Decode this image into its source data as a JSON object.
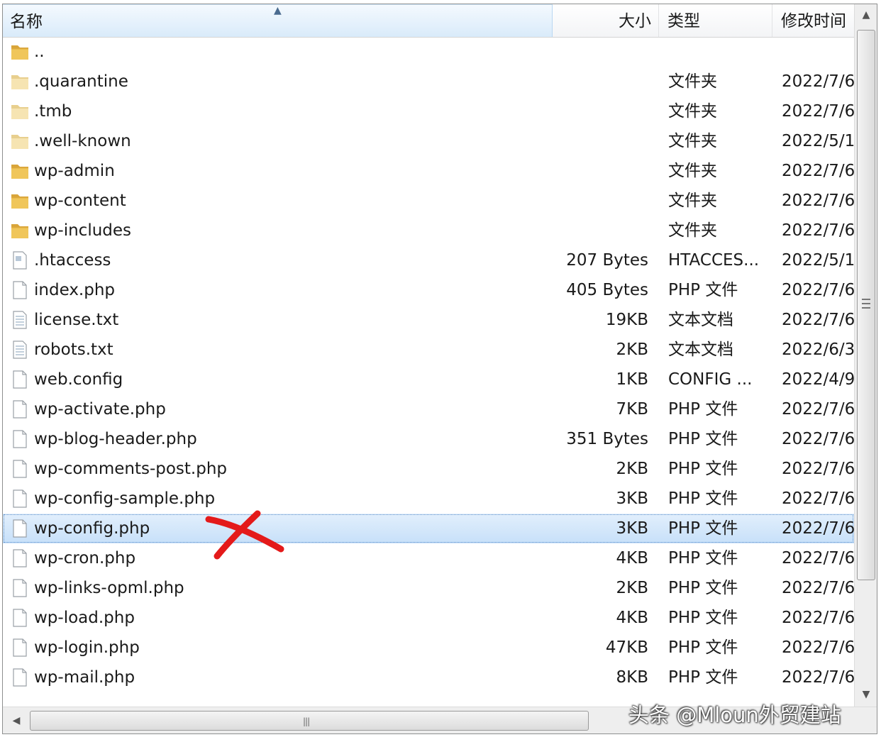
{
  "columns": {
    "name": "名称",
    "size": "大小",
    "type": "类型",
    "date": "修改时间"
  },
  "rows": [
    {
      "icon": "folder-icon",
      "name": "..",
      "size": "",
      "type": "",
      "date": ""
    },
    {
      "icon": "folder-light-icon",
      "name": ".quarantine",
      "size": "",
      "type": "文件夹",
      "date": "2022/7/6"
    },
    {
      "icon": "folder-light-icon",
      "name": ".tmb",
      "size": "",
      "type": "文件夹",
      "date": "2022/7/6"
    },
    {
      "icon": "folder-light-icon",
      "name": ".well-known",
      "size": "",
      "type": "文件夹",
      "date": "2022/5/1"
    },
    {
      "icon": "folder-icon",
      "name": "wp-admin",
      "size": "",
      "type": "文件夹",
      "date": "2022/7/6"
    },
    {
      "icon": "folder-icon",
      "name": "wp-content",
      "size": "",
      "type": "文件夹",
      "date": "2022/7/6"
    },
    {
      "icon": "folder-icon",
      "name": "wp-includes",
      "size": "",
      "type": "文件夹",
      "date": "2022/7/6"
    },
    {
      "icon": "htaccess-file-icon",
      "name": ".htaccess",
      "size": "207 Bytes",
      "type": "HTACCES...",
      "date": "2022/5/1"
    },
    {
      "icon": "file-icon",
      "name": "index.php",
      "size": "405 Bytes",
      "type": "PHP 文件",
      "date": "2022/7/6"
    },
    {
      "icon": "text-file-icon",
      "name": "license.txt",
      "size": "19KB",
      "type": "文本文档",
      "date": "2022/7/6"
    },
    {
      "icon": "text-file-icon",
      "name": "robots.txt",
      "size": "2KB",
      "type": "文本文档",
      "date": "2022/6/3"
    },
    {
      "icon": "file-icon",
      "name": "web.config",
      "size": "1KB",
      "type": "CONFIG ...",
      "date": "2022/4/9"
    },
    {
      "icon": "file-icon",
      "name": "wp-activate.php",
      "size": "7KB",
      "type": "PHP 文件",
      "date": "2022/7/6"
    },
    {
      "icon": "file-icon",
      "name": "wp-blog-header.php",
      "size": "351 Bytes",
      "type": "PHP 文件",
      "date": "2022/7/6"
    },
    {
      "icon": "file-icon",
      "name": "wp-comments-post.php",
      "size": "2KB",
      "type": "PHP 文件",
      "date": "2022/7/6"
    },
    {
      "icon": "file-icon",
      "name": "wp-config-sample.php",
      "size": "3KB",
      "type": "PHP 文件",
      "date": "2022/7/6"
    },
    {
      "icon": "file-icon",
      "name": "wp-config.php",
      "size": "3KB",
      "type": "PHP 文件",
      "date": "2022/7/6",
      "selected": true
    },
    {
      "icon": "file-icon",
      "name": "wp-cron.php",
      "size": "4KB",
      "type": "PHP 文件",
      "date": "2022/7/6"
    },
    {
      "icon": "file-icon",
      "name": "wp-links-opml.php",
      "size": "2KB",
      "type": "PHP 文件",
      "date": "2022/7/6"
    },
    {
      "icon": "file-icon",
      "name": "wp-load.php",
      "size": "4KB",
      "type": "PHP 文件",
      "date": "2022/7/6"
    },
    {
      "icon": "file-icon",
      "name": "wp-login.php",
      "size": "47KB",
      "type": "PHP 文件",
      "date": "2022/7/6"
    },
    {
      "icon": "file-icon",
      "name": "wp-mail.php",
      "size": "8KB",
      "type": "PHP 文件",
      "date": "2022/7/6"
    }
  ],
  "watermark": "头条 @Mloun外贸建站",
  "colors": {
    "selection": "#c7e0f9",
    "header_active": "#d9ebfa",
    "folder": "#e8b84a",
    "annotation_mark": "#e41a1a"
  }
}
